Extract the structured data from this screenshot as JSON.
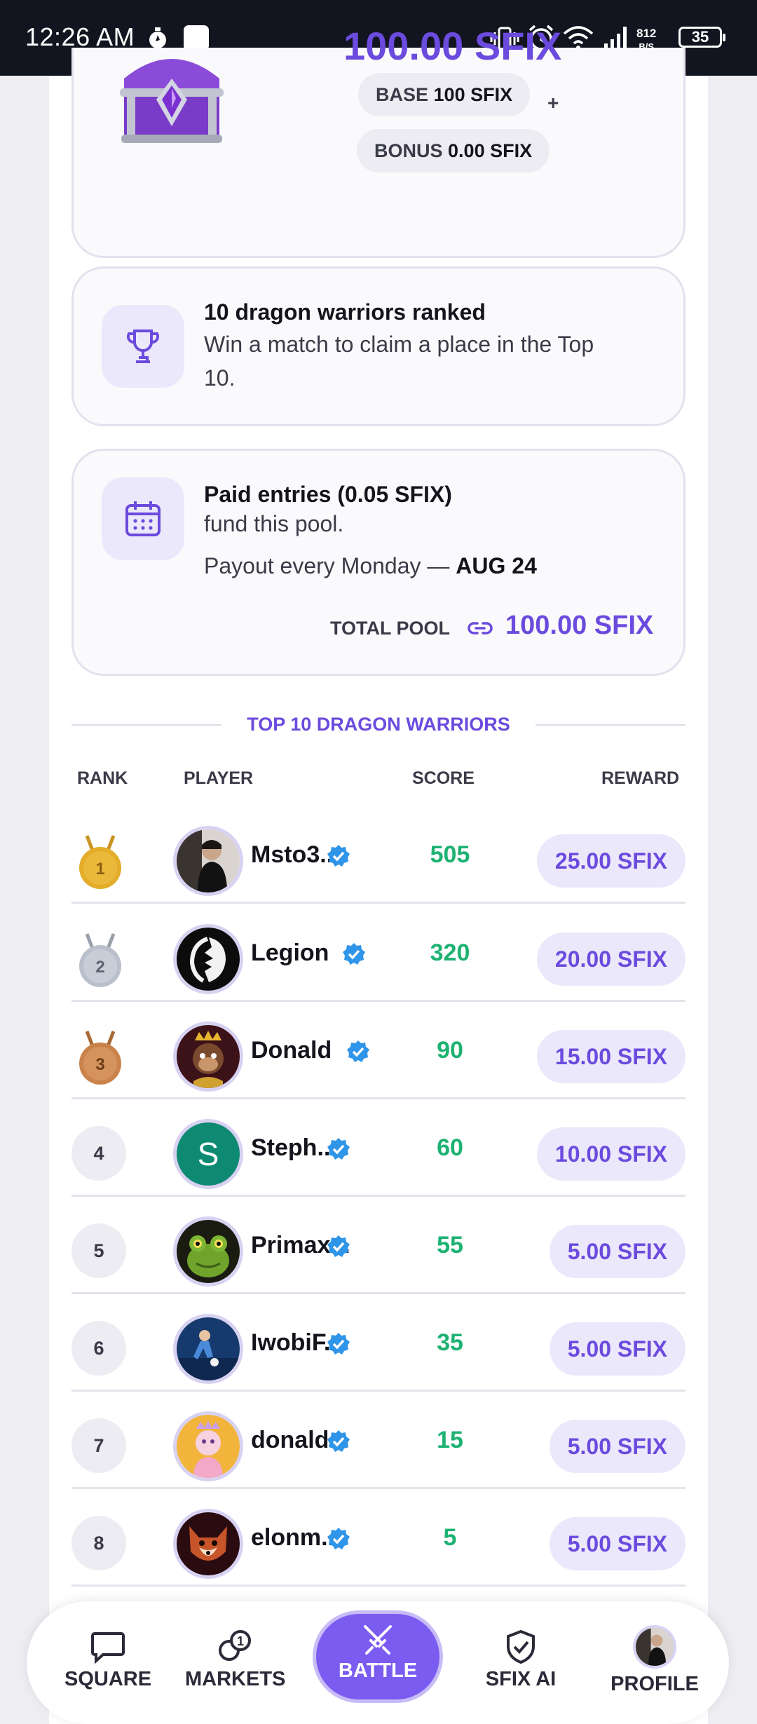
{
  "status_bar": {
    "time": "12:26 AM",
    "net_speed_top": "812",
    "net_speed_bottom": "B/S",
    "battery": "35"
  },
  "reward_card": {
    "amount": "100.00 SFIX",
    "base_label": "BASE",
    "base_value": "100 SFIX",
    "plus": "+",
    "bonus_label": "BONUS",
    "bonus_value": "0.00 SFIX"
  },
  "rank_card": {
    "title": "10 dragon warriors ranked",
    "text_line1": "Win a match to claim a place in the Top",
    "text_line2": "10."
  },
  "pool_card": {
    "title": "Paid entries (0.05 SFIX)",
    "subtitle": "fund this pool.",
    "payout_prefix": "Payout every Monday —",
    "payout_date": "AUG 24",
    "total_label": "TOTAL POOL",
    "total_value": "100.00 SFIX"
  },
  "leaderboard": {
    "title": "TOP 10 DRAGON WARRIORS",
    "headers": {
      "rank": "RANK",
      "player": "PLAYER",
      "score": "SCORE",
      "reward": "REWARD"
    },
    "rows": [
      {
        "rank": "1",
        "name": "Msto3...",
        "score": "505",
        "reward": "25.00 SFIX"
      },
      {
        "rank": "2",
        "name": "Legion",
        "score": "320",
        "reward": "20.00 SFIX"
      },
      {
        "rank": "3",
        "name": "Donald",
        "score": "90",
        "reward": "15.00 SFIX"
      },
      {
        "rank": "4",
        "name": "Steph...",
        "score": "60",
        "reward": "10.00 SFIX",
        "initial": "S"
      },
      {
        "rank": "5",
        "name": "Primax...",
        "score": "55",
        "reward": "5.00 SFIX"
      },
      {
        "rank": "6",
        "name": "IwobiF...",
        "score": "35",
        "reward": "5.00 SFIX"
      },
      {
        "rank": "7",
        "name": "donald...",
        "score": "15",
        "reward": "5.00 SFIX"
      },
      {
        "rank": "8",
        "name": "elonm...",
        "score": "5",
        "reward": "5.00 SFIX"
      }
    ]
  },
  "nav": {
    "square": "SQUARE",
    "markets": "MARKETS",
    "markets_badge": "1",
    "battle": "BATTLE",
    "sfix_ai": "SFIX AI",
    "profile": "PROFILE"
  },
  "colors": {
    "accent": "#6b4bde",
    "score_green": "#1db272",
    "verified_blue": "#2f95e8",
    "gold": "#e3ad2a",
    "silver": "#b9c0cc",
    "bronze": "#c9834a"
  }
}
